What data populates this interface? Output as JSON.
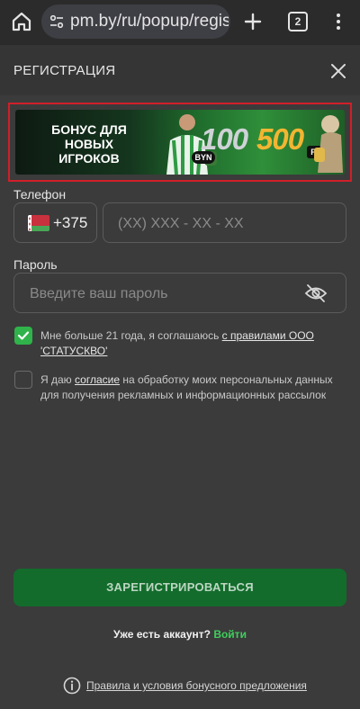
{
  "browser": {
    "url": "pm.by/ru/popup/registra",
    "tab_count": "2",
    "icons": [
      "home-icon",
      "site-settings-icon",
      "plus-icon",
      "tabs-icon",
      "more-vert-icon"
    ]
  },
  "modal": {
    "title": "РЕГИСТРАЦИЯ",
    "close_icon": "close-icon"
  },
  "banner": {
    "text": "БОНУС ДЛЯ НОВЫХ ИГРОКОВ",
    "amount_byn": "100",
    "amount_fs": "500",
    "byn_label": "BYN",
    "fs_label": "FS"
  },
  "form": {
    "phone_label": "Телефон",
    "country_code": "+375",
    "phone_placeholder": "(XX) XXX - XX - XX",
    "password_label": "Пароль",
    "password_placeholder": "Введите ваш пароль",
    "age_check": {
      "checked": true,
      "text": "Мне больше 21 года, я соглашаюсь ",
      "link": "с правилами ООО 'СТАТУСКВО'"
    },
    "consent_check": {
      "checked": false,
      "text_before": "Я даю ",
      "link": "согласие",
      "text_after": " на обработку моих персональных данных для получения рекламных и информационных рассылок"
    },
    "register_button": "ЗАРЕГИСТРИРОВАТЬСЯ"
  },
  "footer": {
    "have_account": "Уже есть аккаунт?",
    "login_link": "Войти",
    "terms_link": "Правила и условия бонусного предложения"
  },
  "colors": {
    "accent_green": "#2fb34a",
    "register_button": "#136c2c",
    "highlight_border": "#d11f2a",
    "background": "#3b3b3b"
  }
}
